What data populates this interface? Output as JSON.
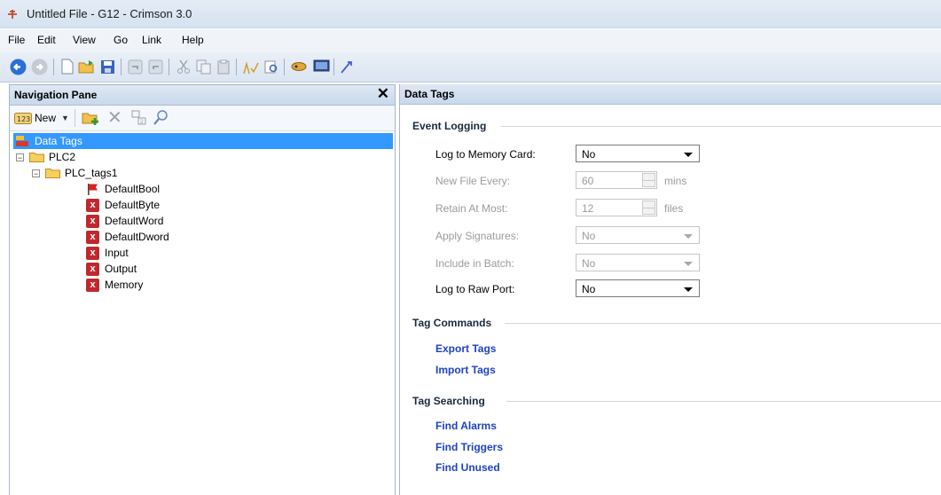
{
  "window": {
    "title": "Untitled File - G12 - Crimson 3.0"
  },
  "menu": [
    "File",
    "Edit",
    "View",
    "Go",
    "Link",
    "Help"
  ],
  "nav_pane": {
    "title": "Navigation Pane",
    "new_label": "New",
    "tree": {
      "root": "Data Tags",
      "plc": "PLC2",
      "group": "PLC_tags1",
      "tags": [
        "DefaultBool",
        "DefaultByte",
        "DefaultWord",
        "DefaultDword",
        "Input",
        "Output",
        "Memory"
      ]
    }
  },
  "main": {
    "title": "Data Tags",
    "event_logging": {
      "heading": "Event Logging",
      "log_to_memory_card": {
        "label": "Log to Memory Card:",
        "value": "No"
      },
      "new_file_every": {
        "label": "New File Every:",
        "value": "60",
        "unit": "mins"
      },
      "retain_at_most": {
        "label": "Retain At Most:",
        "value": "12",
        "unit": "files"
      },
      "apply_signatures": {
        "label": "Apply Signatures:",
        "value": "No"
      },
      "include_in_batch": {
        "label": "Include in Batch:",
        "value": "No"
      },
      "log_to_raw_port": {
        "label": "Log to Raw Port:",
        "value": "No"
      }
    },
    "tag_commands": {
      "heading": "Tag Commands",
      "links": [
        "Export Tags",
        "Import Tags"
      ]
    },
    "tag_searching": {
      "heading": "Tag Searching",
      "links": [
        "Find Alarms",
        "Find Triggers",
        "Find Unused"
      ]
    }
  },
  "colors": {
    "selection": "#3399ff",
    "link": "#1d42c4",
    "error_icon": "#c0282d"
  }
}
